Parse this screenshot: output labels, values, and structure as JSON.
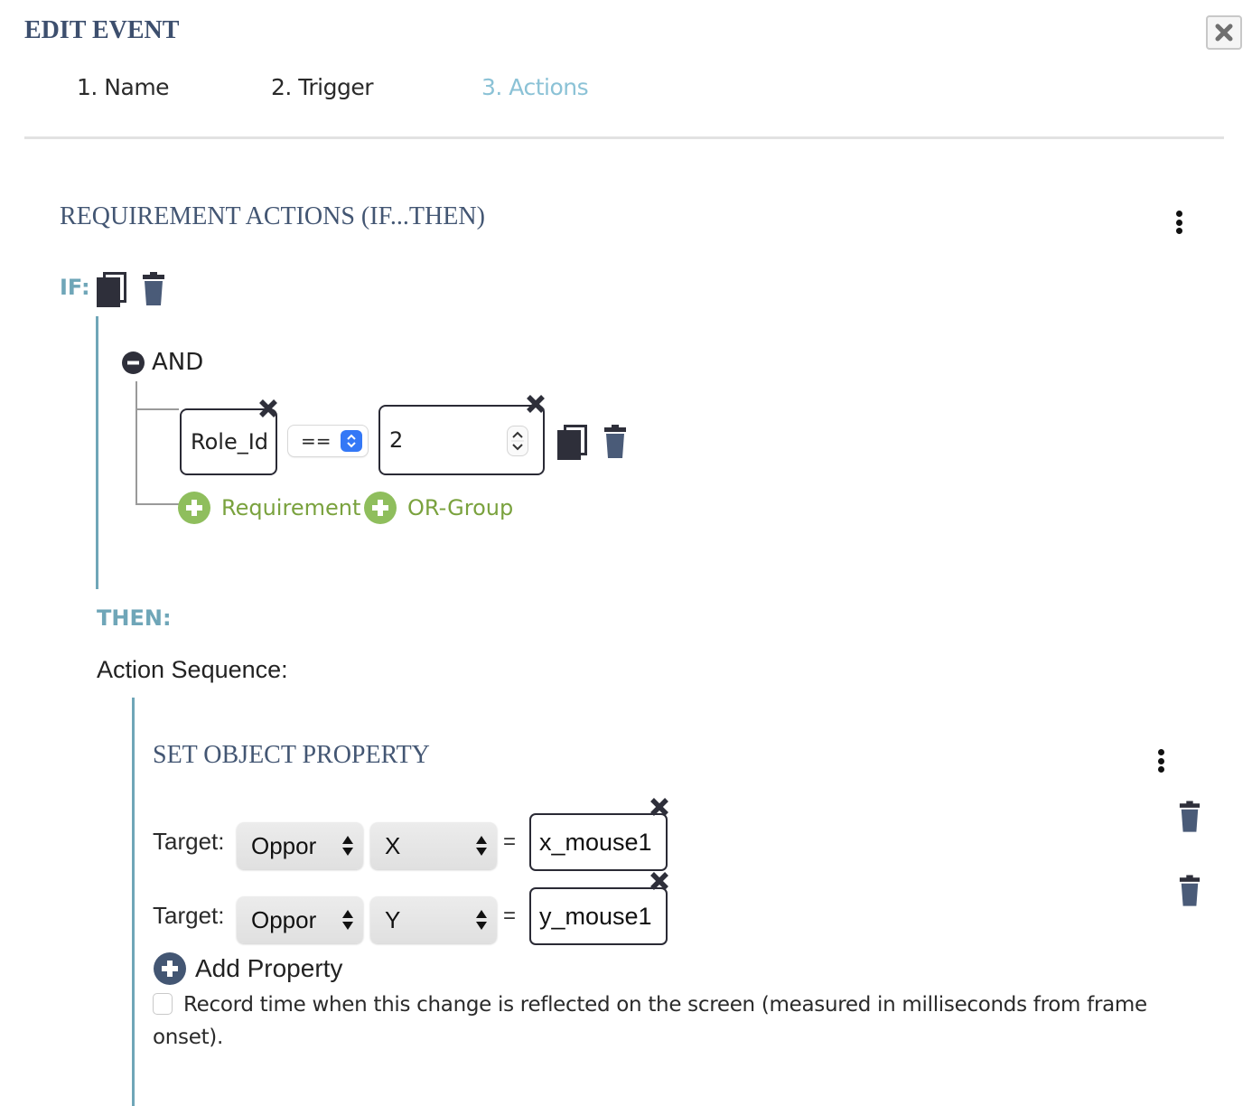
{
  "dialog": {
    "title": "EDIT EVENT",
    "close_icon": "close-icon"
  },
  "tabs": [
    {
      "label": "1. Name",
      "active": false
    },
    {
      "label": "2. Trigger",
      "active": false
    },
    {
      "label": "3. Actions",
      "active": true
    }
  ],
  "requirement_actions": {
    "title": "REQUIREMENT ACTIONS (IF...THEN)",
    "menu_icon": "kebab-menu-icon",
    "if_label": "IF:",
    "group": {
      "operator": "AND",
      "collapse_icon": "minus-circle-icon",
      "condition": {
        "variable": "Role_Id",
        "comparator": "==",
        "value": "2"
      },
      "add_requirement_label": "Requirement",
      "add_or_group_label": "OR-Group"
    },
    "then_label": "THEN:",
    "action_sequence_label": "Action Sequence:"
  },
  "set_object_property": {
    "title": "SET OBJECT PROPERTY",
    "properties": [
      {
        "target_label": "Target:",
        "object": "Oppor",
        "property": "X",
        "equals": "=",
        "value": "x_mouse1"
      },
      {
        "target_label": "Target:",
        "object": "Oppor",
        "property": "Y",
        "equals": "=",
        "value": "y_mouse1"
      }
    ],
    "add_property_label": "Add Property",
    "record_time_checked": false,
    "record_time_label": "Record time when this change is reflected on the screen (measured in milliseconds from frame onset)."
  },
  "colors": {
    "title": "#3d4f6e",
    "active_tab": "#8bc2d6",
    "teal": "#6fa6b8",
    "green": "#8fbe5d",
    "navy": "#435673"
  }
}
